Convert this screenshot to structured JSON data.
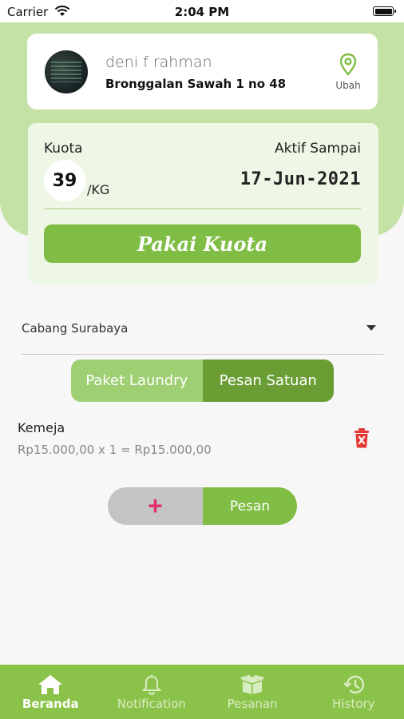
{
  "status_bar": {
    "carrier": "Carrier",
    "time": "2:04 PM"
  },
  "profile": {
    "name": "deni f rahman",
    "address": "Bronggalan Sawah 1 no 48",
    "edit_label": "Ubah"
  },
  "quota": {
    "label": "Kuota",
    "value": "39",
    "unit": "/KG",
    "active_label": "Aktif Sampai",
    "active_date": "17-Jun-2021",
    "use_button": "Pakai Kuota"
  },
  "branch": {
    "selected": "Cabang Surabaya"
  },
  "segments": [
    {
      "label": "Paket Laundry",
      "active": false
    },
    {
      "label": "Pesan Satuan",
      "active": true
    }
  ],
  "order_items": [
    {
      "name": "Kemeja",
      "detail": "Rp15.000,00 x 1 = Rp15.000,00"
    }
  ],
  "actions": {
    "add_symbol": "+",
    "order_label": "Pesan"
  },
  "bottom_nav": [
    {
      "label": "Beranda",
      "icon": "home-icon",
      "active": true
    },
    {
      "label": "Notification",
      "icon": "bell-icon",
      "active": false
    },
    {
      "label": "Pesanan",
      "icon": "box-icon",
      "active": false
    },
    {
      "label": "History",
      "icon": "history-icon",
      "active": false
    }
  ],
  "colors": {
    "primary_green": "#7fbd45",
    "light_green": "#c4e2a5",
    "nav_green": "#8bc34a",
    "delete_red": "#e53935",
    "add_pink": "#e0306e"
  }
}
